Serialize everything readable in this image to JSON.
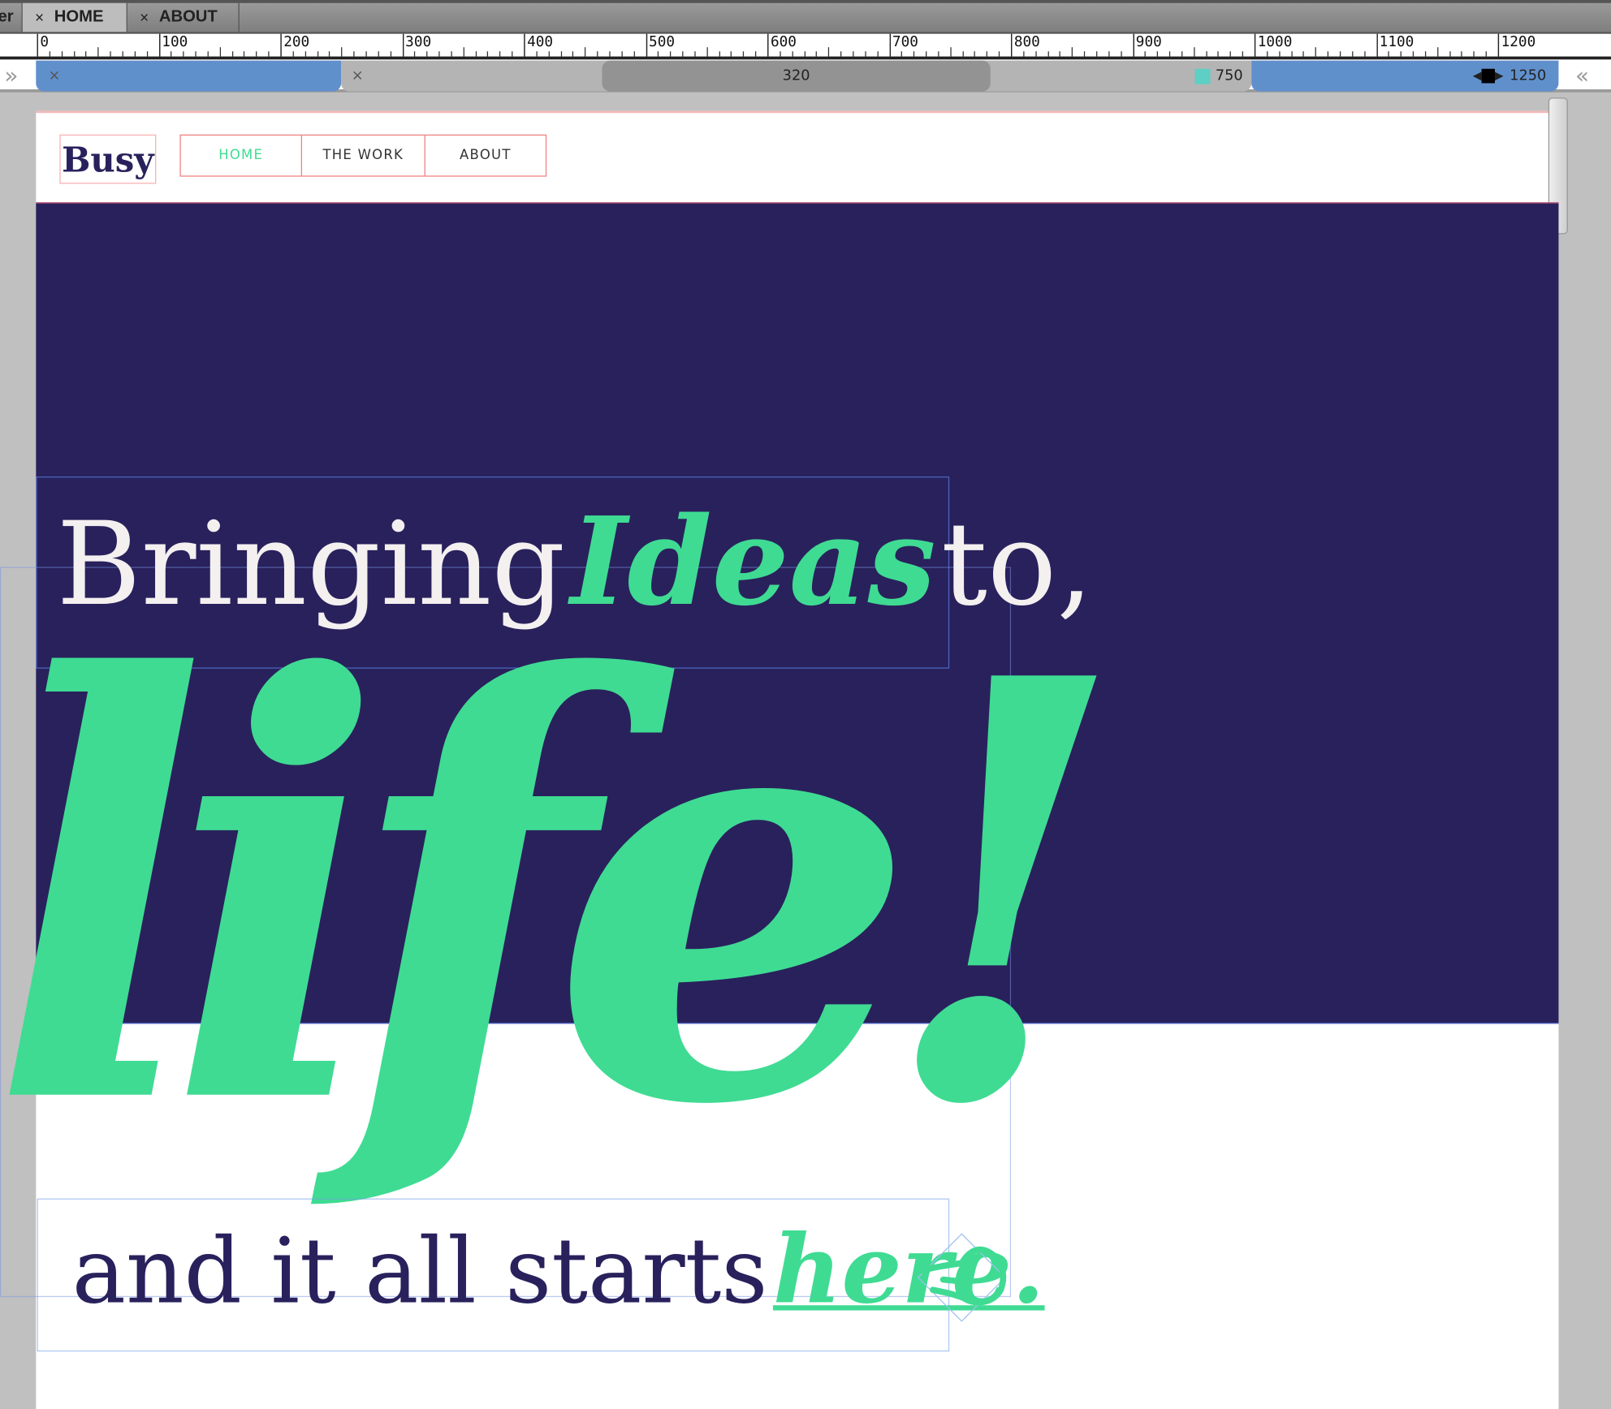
{
  "tabs": [
    {
      "label": "er",
      "partial": true
    },
    {
      "label": "HOME",
      "active": true
    },
    {
      "label": "ABOUT"
    }
  ],
  "tab_close_glyph": "×",
  "ruler": {
    "labels": [
      "0",
      "100",
      "200",
      "300",
      "400",
      "500",
      "600",
      "700",
      "800",
      "900",
      "1000",
      "1100",
      "1200"
    ]
  },
  "breakpoints": {
    "close_glyph": "×",
    "mid": "320",
    "tablet": "750",
    "desktop": "1250",
    "collapse_left": "»",
    "collapse_right": "«"
  },
  "site": {
    "logo": "Busy",
    "nav": [
      {
        "label": "HOME",
        "active": true
      },
      {
        "label": "THE WORK"
      },
      {
        "label": "ABOUT"
      }
    ],
    "hero": {
      "line1_a": "Bringing",
      "line1_b": "Ideas",
      "line1_c": "to,",
      "big": "life!"
    },
    "cta": {
      "text": "and it all starts",
      "link": "here."
    }
  },
  "colors": {
    "accent": "#3fdb93",
    "navy": "#29215c",
    "breakpoint_blue": "#6090cc",
    "tablet_marker": "#5ecfc4"
  }
}
